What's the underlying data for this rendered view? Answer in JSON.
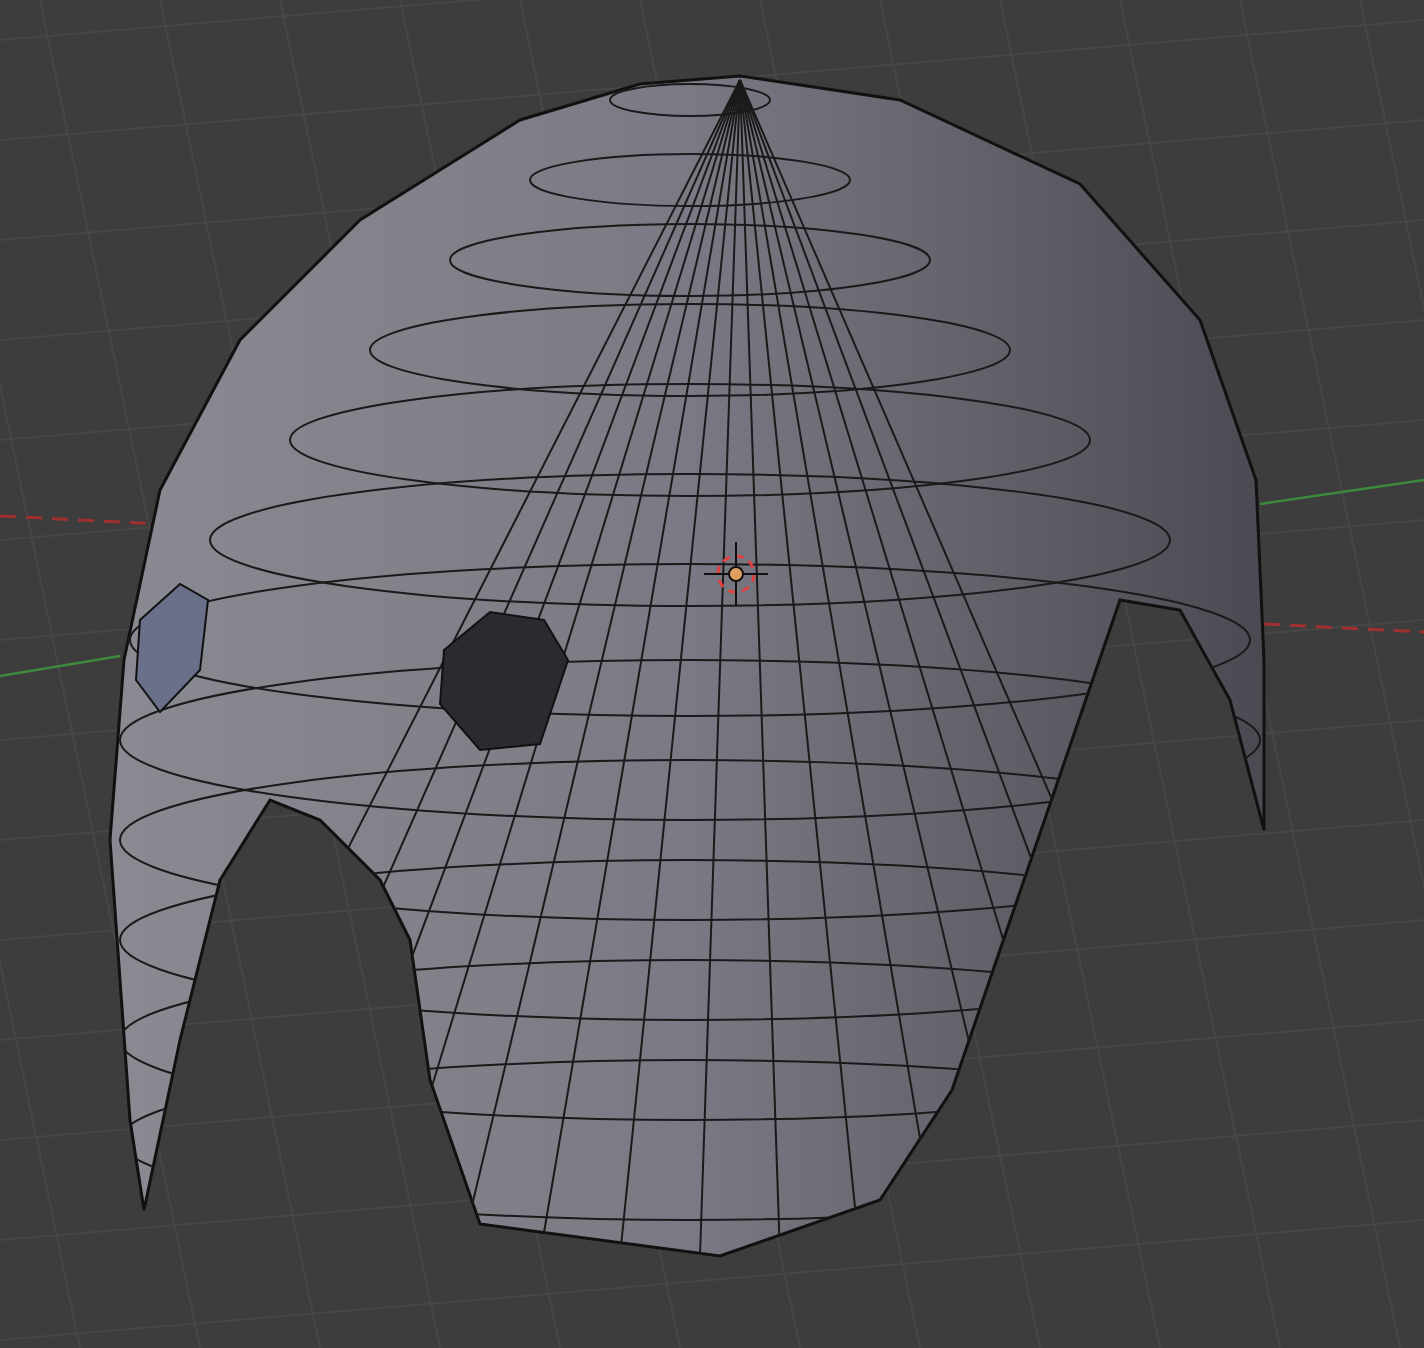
{
  "viewport": {
    "axes_visible": true,
    "cursor_visible": true
  }
}
